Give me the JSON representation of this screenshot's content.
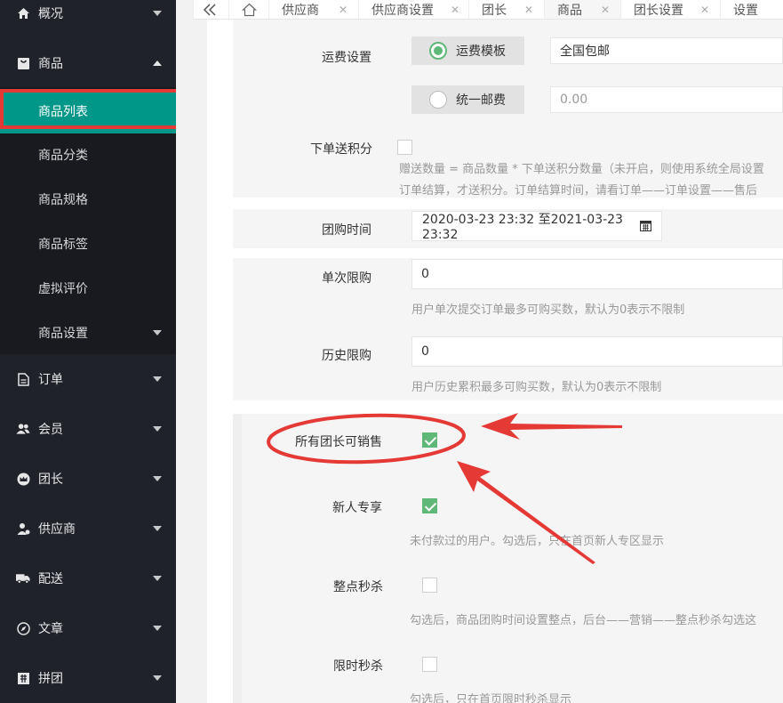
{
  "sidebar": {
    "overview": "概况",
    "goods": "商品",
    "sub": [
      "商品列表",
      "商品分类",
      "商品规格",
      "商品标签",
      "虚拟评价",
      "商品设置"
    ],
    "order": "订单",
    "member": "会员",
    "leader": "团长",
    "supplier": "供应商",
    "delivery": "配送",
    "article": "文章",
    "group": "拼团"
  },
  "tabs": [
    "供应商",
    "供应商设置",
    "团长",
    "商品",
    "团长设置",
    "设置"
  ],
  "form": {
    "shipping_label": "运费设置",
    "shipping_template_label": "运费模板",
    "shipping_template_value": "全国包邮",
    "flat_shipping_label": "统一邮费",
    "flat_shipping_placeholder": "0.00",
    "order_points_label": "下单送积分",
    "order_points_help_1": "赠送数量 = 商品数量 * 下单送积分数量（未开启，则使用系统全局设置",
    "order_points_help_2": "订单结算，才送积分。订单结算时间，请看订单——订单设置——售后",
    "group_time_label": "团购时间",
    "group_time_value": "2020-03-23 23:32 至2021-03-23 23:32",
    "single_limit_label": "单次限购",
    "single_limit_value": "0",
    "single_limit_help": "用户单次提交订单最多可购买数，默认为0表示不限制",
    "history_limit_label": "历史限购",
    "history_limit_value": "0",
    "history_limit_help": "用户历史累积最多可购买数，默认为0表示不限制",
    "all_leaders_label": "所有团长可销售",
    "newcomer_label": "新人专享",
    "newcomer_help": "未付款过的用户。勾选后，只在首页新人专区显示",
    "flash_label": "整点秒杀",
    "flash_help": "勾选后，商品团购时间设置整点，后台——营销——整点秒杀勾选这",
    "limited_label": "限时秒杀",
    "limited_help": "勾选后，只在首页限时秒杀显示"
  },
  "colors": {
    "sidebar_bg": "#20222a",
    "active_item": "#009688",
    "checkbox_checked": "#5fb878",
    "annotation": "#e53935"
  }
}
